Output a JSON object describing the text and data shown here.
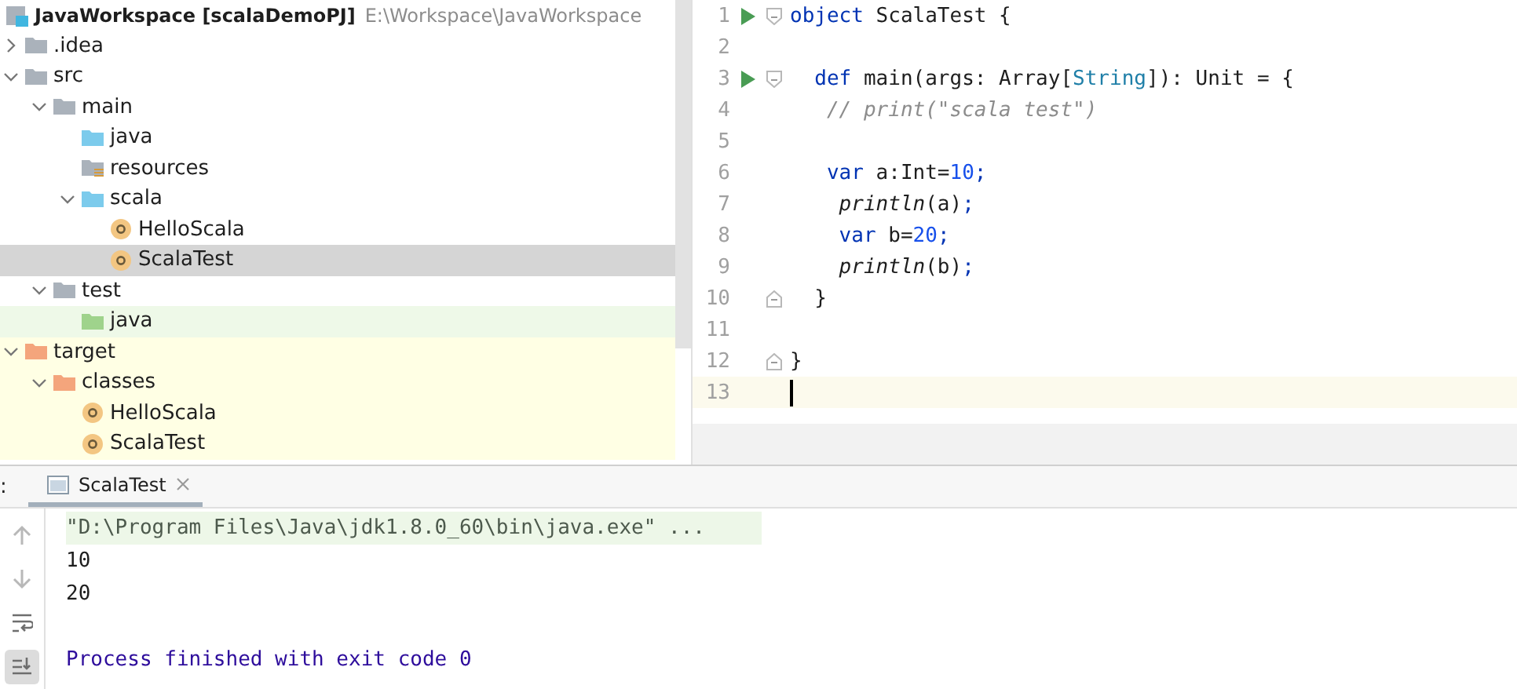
{
  "project": {
    "name": "JavaWorkspace [scalaDemoPJ]",
    "path": "E:\\Workspace\\JavaWorkspace"
  },
  "tree": [
    {
      "label": ".idea",
      "kind": "folder",
      "expanded": false,
      "selected": false
    },
    {
      "label": "src",
      "kind": "folder",
      "expanded": true,
      "selected": false,
      "children": [
        {
          "label": "main",
          "kind": "folder",
          "expanded": true,
          "selected": false,
          "children": [
            {
              "label": "java",
              "kind": "source",
              "selected": false
            },
            {
              "label": "resources",
              "kind": "resources",
              "selected": false
            },
            {
              "label": "scala",
              "kind": "source",
              "expanded": true,
              "selected": false,
              "children": [
                {
                  "label": "HelloScala",
                  "kind": "object",
                  "selected": false
                },
                {
                  "label": "ScalaTest",
                  "kind": "object",
                  "selected": true
                }
              ]
            }
          ]
        },
        {
          "label": "test",
          "kind": "folder",
          "expanded": true,
          "selected": false,
          "children": [
            {
              "label": "java",
              "kind": "test",
              "selected": false
            }
          ]
        }
      ]
    },
    {
      "label": "target",
      "kind": "excluded",
      "expanded": true,
      "selected": false,
      "children": [
        {
          "label": "classes",
          "kind": "excluded",
          "expanded": true,
          "selected": false,
          "children": [
            {
              "label": "HelloScala",
              "kind": "object",
              "selected": false
            },
            {
              "label": "ScalaTest",
              "kind": "object",
              "selected": false
            }
          ]
        }
      ]
    }
  ],
  "editor": {
    "lines": [
      {
        "number": "1",
        "run": true,
        "fold_open": true,
        "current": false,
        "tokens": [
          {
            "kind": "keyword",
            "text": "object"
          },
          {
            "kind": "plain",
            "text": " ScalaTest {"
          }
        ]
      },
      {
        "number": "2",
        "run": false,
        "current": false
      },
      {
        "number": "3",
        "run": true,
        "fold_open": true,
        "current": false,
        "tokens": [
          {
            "kind": "keyword",
            "text": "  def"
          },
          {
            "kind": "plain",
            "text": " main(args: Array["
          },
          {
            "kind": "type",
            "text": "String"
          },
          {
            "kind": "plain",
            "text": "]): Unit = {"
          }
        ]
      },
      {
        "number": "4",
        "run": false,
        "current": false,
        "tokens": [
          {
            "kind": "comment",
            "text": "   // print(\"scala test\")"
          }
        ]
      },
      {
        "number": "5",
        "run": false,
        "current": false
      },
      {
        "number": "6",
        "run": false,
        "current": false,
        "tokens": [
          {
            "kind": "keyword",
            "text": "   var"
          },
          {
            "kind": "plain",
            "text": " a:Int="
          },
          {
            "kind": "number",
            "text": "10"
          },
          {
            "kind": "keyword",
            "text": ";"
          }
        ]
      },
      {
        "number": "7",
        "run": false,
        "current": false,
        "tokens": [
          {
            "kind": "call",
            "text": "    println"
          },
          {
            "kind": "plain",
            "text": "(a)"
          },
          {
            "kind": "keyword",
            "text": ";"
          }
        ]
      },
      {
        "number": "8",
        "run": false,
        "current": false,
        "tokens": [
          {
            "kind": "keyword",
            "text": "    var"
          },
          {
            "kind": "plain",
            "text": " b="
          },
          {
            "kind": "number",
            "text": "20"
          },
          {
            "kind": "keyword",
            "text": ";"
          }
        ]
      },
      {
        "number": "9",
        "run": false,
        "current": false,
        "tokens": [
          {
            "kind": "call",
            "text": "    println"
          },
          {
            "kind": "plain",
            "text": "(b)"
          },
          {
            "kind": "keyword",
            "text": ";"
          }
        ]
      },
      {
        "number": "10",
        "run": false,
        "fold_close": true,
        "current": false,
        "tokens": [
          {
            "kind": "plain",
            "text": "  }"
          }
        ]
      },
      {
        "number": "11",
        "run": false,
        "current": false
      },
      {
        "number": "12",
        "run": false,
        "fold_close": true,
        "current": false,
        "tokens": [
          {
            "kind": "plain",
            "text": "}"
          }
        ]
      },
      {
        "number": "13",
        "run": false,
        "current": true
      }
    ]
  },
  "run_panel": {
    "label": ":",
    "tabs": [
      {
        "label": "ScalaTest",
        "selected": true
      }
    ],
    "toolbar": [
      {
        "kind": "up",
        "selected": false
      },
      {
        "kind": "down",
        "selected": false
      },
      {
        "kind": "wrap",
        "selected": false
      },
      {
        "kind": "scroll-end",
        "selected": true
      }
    ],
    "console": [
      {
        "kind": "command",
        "text": "\"D:\\Program Files\\Java\\jdk1.8.0_60\\bin\\java.exe\" ..."
      },
      {
        "kind": "output",
        "text": "10"
      },
      {
        "kind": "output",
        "text": "20"
      },
      {
        "kind": "blank"
      },
      {
        "kind": "exit",
        "text": "Process finished with exit code 0"
      }
    ]
  }
}
